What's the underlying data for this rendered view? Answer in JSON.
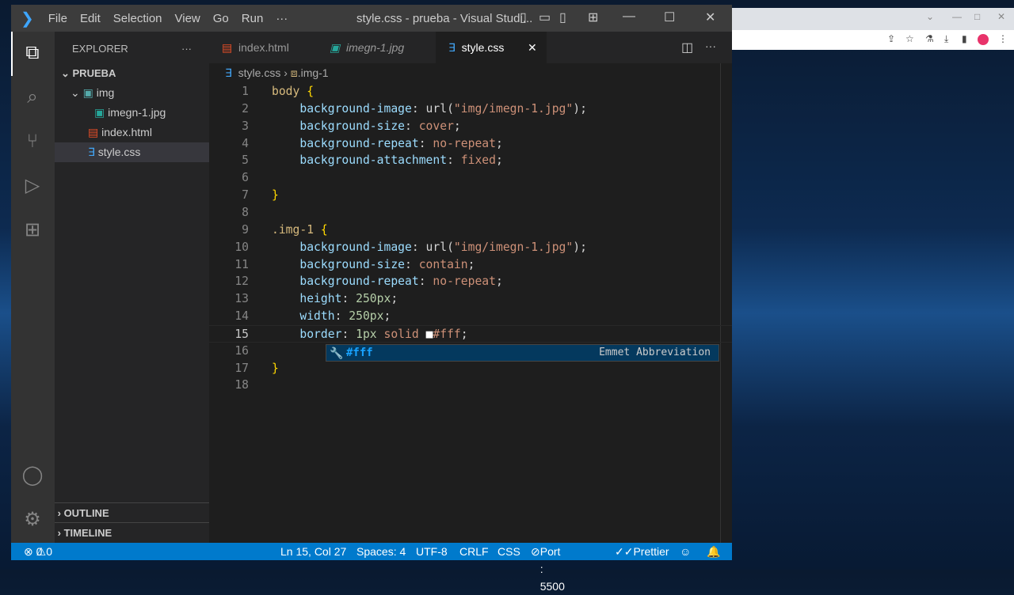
{
  "window": {
    "title": "style.css - prueba - Visual Studi...",
    "menu": [
      "File",
      "Edit",
      "Selection",
      "View",
      "Go",
      "Run",
      "···"
    ]
  },
  "sidebar": {
    "header": "EXPLORER",
    "more": "···",
    "folder": "PRUEBA",
    "items": [
      {
        "label": "img",
        "kind": "folder"
      },
      {
        "label": "imegn-1.jpg",
        "kind": "image"
      },
      {
        "label": "index.html",
        "kind": "html"
      },
      {
        "label": "style.css",
        "kind": "css",
        "selected": true
      }
    ],
    "outline": "OUTLINE",
    "timeline": "TIMELINE"
  },
  "tabs": [
    {
      "label": "index.html",
      "icon": "html-icon"
    },
    {
      "label": "imegn-1.jpg",
      "icon": "image-icon"
    },
    {
      "label": "style.css",
      "icon": "css-icon",
      "active": true
    }
  ],
  "breadcrumb": {
    "file": "style.css",
    "symbol": ".img-1"
  },
  "code": [
    [
      [
        "body ",
        "sel"
      ],
      [
        "{",
        "br"
      ]
    ],
    [
      [
        "    background-image",
        "prop"
      ],
      [
        ": ",
        "pun"
      ],
      [
        "url(",
        "pun"
      ],
      [
        "\"img/imegn-1.jpg\"",
        "str"
      ],
      [
        ");",
        "pun"
      ]
    ],
    [
      [
        "    background-size",
        "prop"
      ],
      [
        ": ",
        "pun"
      ],
      [
        "cover",
        "val"
      ],
      [
        ";",
        "pun"
      ]
    ],
    [
      [
        "    background-repeat",
        "prop"
      ],
      [
        ": ",
        "pun"
      ],
      [
        "no-repeat",
        "val"
      ],
      [
        ";",
        "pun"
      ]
    ],
    [
      [
        "    background-attachment",
        "prop"
      ],
      [
        ": ",
        "pun"
      ],
      [
        "fixed",
        "val"
      ],
      [
        ";",
        "pun"
      ]
    ],
    [],
    [
      [
        "}",
        "br"
      ]
    ],
    [],
    [
      [
        ".img-1 ",
        "sel"
      ],
      [
        "{",
        "br"
      ]
    ],
    [
      [
        "    background-image",
        "prop"
      ],
      [
        ": ",
        "pun"
      ],
      [
        "url(",
        "pun"
      ],
      [
        "\"img/imegn-1.jpg\"",
        "str"
      ],
      [
        ");",
        "pun"
      ]
    ],
    [
      [
        "    background-size",
        "prop"
      ],
      [
        ": ",
        "pun"
      ],
      [
        "contain",
        "val"
      ],
      [
        ";",
        "pun"
      ]
    ],
    [
      [
        "    background-repeat",
        "prop"
      ],
      [
        ": ",
        "pun"
      ],
      [
        "no-repeat",
        "val"
      ],
      [
        ";",
        "pun"
      ]
    ],
    [
      [
        "    height",
        "prop"
      ],
      [
        ": ",
        "pun"
      ],
      [
        "250px",
        "num"
      ],
      [
        ";",
        "pun"
      ]
    ],
    [
      [
        "    width",
        "prop"
      ],
      [
        ": ",
        "pun"
      ],
      [
        "250px",
        "num"
      ],
      [
        ";",
        "pun"
      ]
    ],
    [
      [
        "    border",
        "prop"
      ],
      [
        ": ",
        "pun"
      ],
      [
        "1px ",
        "num"
      ],
      [
        "solid ",
        "val"
      ],
      [
        "■",
        "pun"
      ],
      [
        "#fff",
        "val"
      ],
      [
        ";",
        "pun"
      ]
    ],
    [],
    [
      [
        "}",
        "br"
      ]
    ],
    []
  ],
  "suggestion": {
    "label": "#fff",
    "detail": "Emmet Abbreviation"
  },
  "status": {
    "errors": "0",
    "warnings": "0",
    "position": "Ln 15, Col 27",
    "spaces": "Spaces: 4",
    "encoding": "UTF-8",
    "eol": "CRLF",
    "language": "CSS",
    "port": "Port : 5500",
    "prettier": "Prettier"
  },
  "colors": {
    "accent": "#007acc",
    "titlebar": "#3c3c3c",
    "editor": "#1e1e1e"
  }
}
